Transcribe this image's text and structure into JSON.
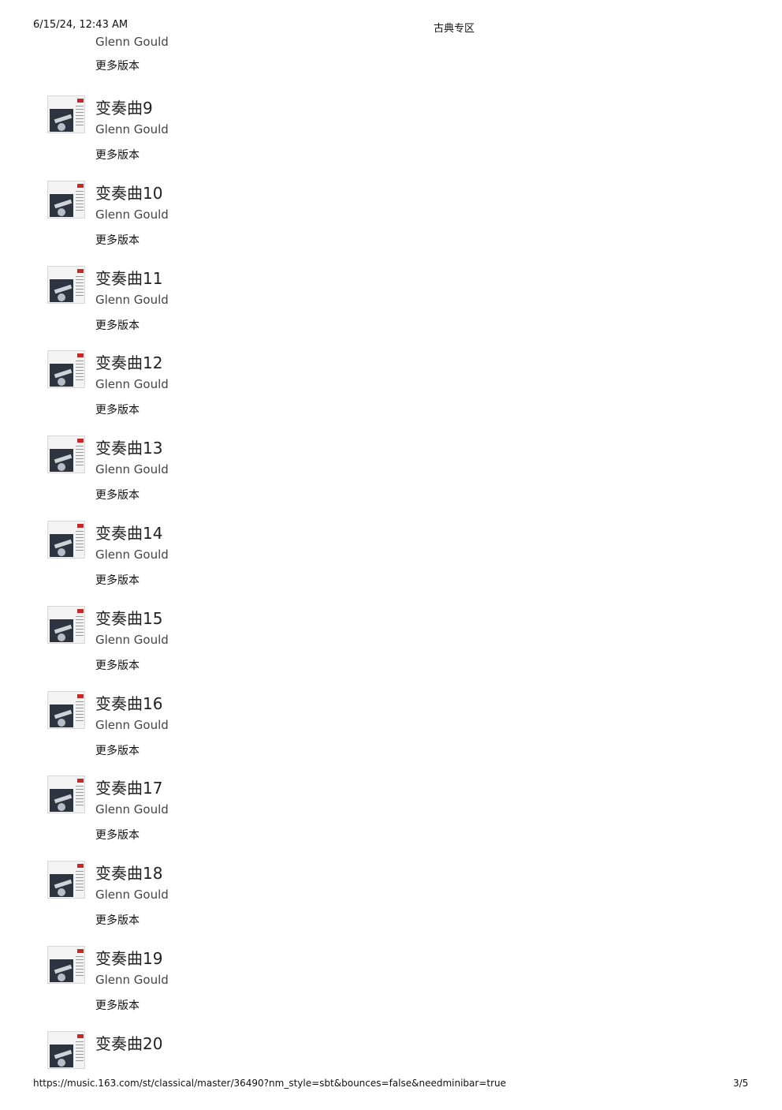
{
  "header": {
    "datetime": "6/15/24, 12:43 AM",
    "page_title": "古典专区"
  },
  "partial_item": {
    "artist": "Glenn Gould",
    "more_label": "更多版本"
  },
  "tracks": [
    {
      "title": "变奏曲9",
      "artist": "Glenn Gould",
      "more_label": "更多版本"
    },
    {
      "title": "变奏曲10",
      "artist": "Glenn Gould",
      "more_label": "更多版本"
    },
    {
      "title": "变奏曲11",
      "artist": "Glenn Gould",
      "more_label": "更多版本"
    },
    {
      "title": "变奏曲12",
      "artist": "Glenn Gould",
      "more_label": "更多版本"
    },
    {
      "title": "变奏曲13",
      "artist": "Glenn Gould",
      "more_label": "更多版本"
    },
    {
      "title": "变奏曲14",
      "artist": "Glenn Gould",
      "more_label": "更多版本"
    },
    {
      "title": "变奏曲15",
      "artist": "Glenn Gould",
      "more_label": "更多版本"
    },
    {
      "title": "变奏曲16",
      "artist": "Glenn Gould",
      "more_label": "更多版本"
    },
    {
      "title": "变奏曲17",
      "artist": "Glenn Gould",
      "more_label": "更多版本"
    },
    {
      "title": "变奏曲18",
      "artist": "Glenn Gould",
      "more_label": "更多版本"
    },
    {
      "title": "变奏曲19",
      "artist": "Glenn Gould",
      "more_label": "更多版本"
    },
    {
      "title": "变奏曲20"
    }
  ],
  "footer": {
    "url": "https://music.163.com/st/classical/master/36490?nm_style=sbt&bounces=false&needminibar=true",
    "page_indicator": "3/5"
  }
}
